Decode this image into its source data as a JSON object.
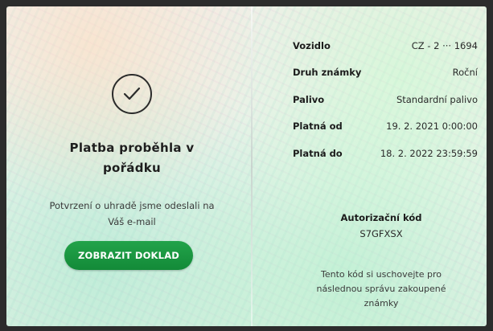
{
  "payment": {
    "status_icon": "check-circle-icon",
    "title": "Platba proběhla v pořádku",
    "confirmation_text": "Potvrzení o uhradě jsme odeslali na Váš e-mail",
    "show_receipt_button": "ZOBRAZIT DOKLAD"
  },
  "vignette": {
    "rows": [
      {
        "label": "Vozidlo",
        "value": "CZ - 2 ··· 1694"
      },
      {
        "label": "Druh známky",
        "value": "Roční"
      },
      {
        "label": "Palivo",
        "value": "Standardní palivo"
      },
      {
        "label": "Platná od",
        "value": "19. 2. 2021 0:00:00"
      },
      {
        "label": "Platná do",
        "value": "18. 2. 2022 23:59:59"
      }
    ],
    "auth_code_label": "Autorizační kód",
    "auth_code_value": "S7GFXSX",
    "auth_code_note": "Tento kód si uschovejte pro následnou správu zakoupené známky"
  },
  "colors": {
    "accent_green": "#1a9640",
    "text_dark": "#1c1c1c"
  }
}
